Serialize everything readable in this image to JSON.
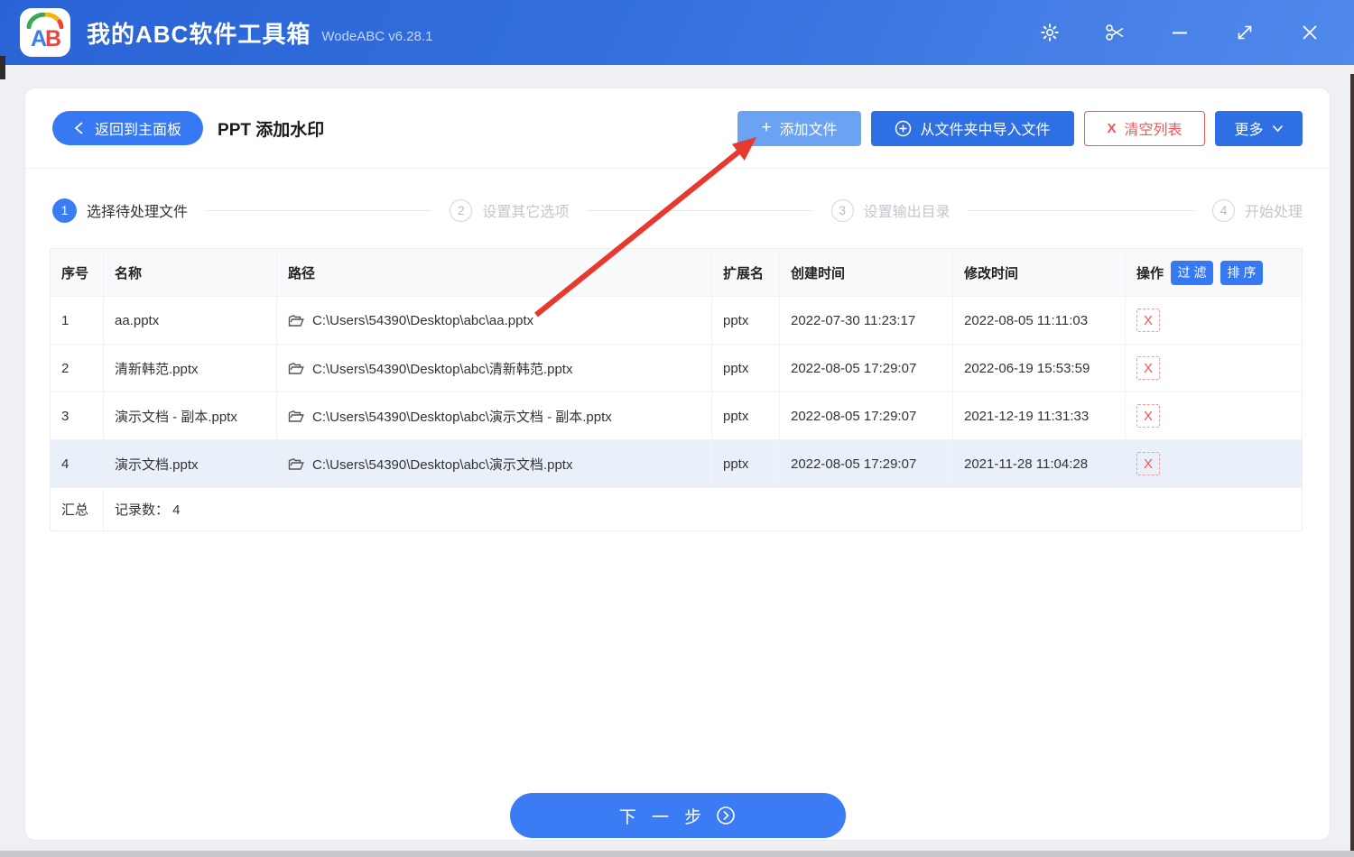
{
  "titlebar": {
    "logo_letter_a": "A",
    "logo_letter_b": "B",
    "title": "我的ABC软件工具箱",
    "version": "WodeABC v6.28.1"
  },
  "toolbar": {
    "back_label": "返回到主面板",
    "page_title": "PPT 添加水印",
    "add_files_label": "添加文件",
    "add_files_icon": "+",
    "import_folder_label": "从文件夹中导入文件",
    "clear_list_label": "清空列表",
    "clear_list_icon": "X",
    "more_label": "更多"
  },
  "steps": [
    {
      "num": "1",
      "label": "选择待处理文件"
    },
    {
      "num": "2",
      "label": "设置其它选项"
    },
    {
      "num": "3",
      "label": "设置输出目录"
    },
    {
      "num": "4",
      "label": "开始处理"
    }
  ],
  "table": {
    "headers": {
      "index": "序号",
      "name": "名称",
      "path": "路径",
      "ext": "扩展名",
      "created": "创建时间",
      "modified": "修改时间",
      "actions": "操作"
    },
    "filter_label": "过滤",
    "sort_label": "排序",
    "delete_label": "X",
    "rows": [
      {
        "index": "1",
        "name": "aa.pptx",
        "path": "C:\\Users\\54390\\Desktop\\abc\\aa.pptx",
        "ext": "pptx",
        "created": "2022-07-30 11:23:17",
        "modified": "2022-08-05 11:11:03"
      },
      {
        "index": "2",
        "name": "清新韩范.pptx",
        "path": "C:\\Users\\54390\\Desktop\\abc\\清新韩范.pptx",
        "ext": "pptx",
        "created": "2022-08-05 17:29:07",
        "modified": "2022-06-19 15:53:59"
      },
      {
        "index": "3",
        "name": "演示文档 - 副本.pptx",
        "path": "C:\\Users\\54390\\Desktop\\abc\\演示文档 - 副本.pptx",
        "ext": "pptx",
        "created": "2022-08-05 17:29:07",
        "modified": "2021-12-19 11:31:33"
      },
      {
        "index": "4",
        "name": "演示文档.pptx",
        "path": "C:\\Users\\54390\\Desktop\\abc\\演示文档.pptx",
        "ext": "pptx",
        "created": "2022-08-05 17:29:07",
        "modified": "2021-11-28 11:04:28"
      }
    ],
    "selected_row": 4,
    "summary_label": "汇总",
    "summary_value": "记录数： 4"
  },
  "footer": {
    "next_label": "下 一 步"
  },
  "colors": {
    "accent_blue": "#3b7cf5",
    "deep_blue": "#2e6fe3",
    "hover_blue": "#6ba3f2",
    "danger_red": "#f25555",
    "arrow_red": "#e8392e",
    "selected_row_bg": "#e9f0fa",
    "titlebar_gradient_start": "#2a63d6",
    "titlebar_gradient_end": "#5189ec"
  }
}
